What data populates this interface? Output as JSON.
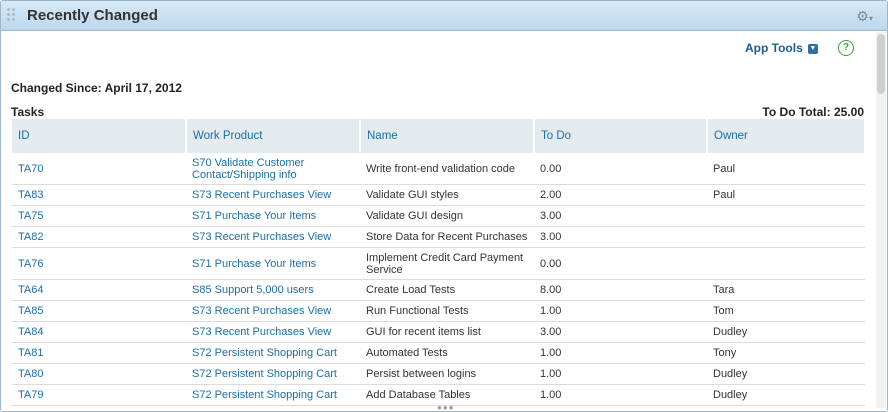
{
  "panel": {
    "title": "Recently Changed"
  },
  "toolbar": {
    "app_tools_label": "App Tools",
    "help_label": "?"
  },
  "changed_since": "Changed Since: April 17, 2012",
  "section_title": "Tasks",
  "todo_total": "To Do Total: 25.00",
  "columns": [
    "ID",
    "Work Product",
    "Name",
    "To Do",
    "Owner"
  ],
  "rows": [
    {
      "id": "TA70",
      "work_product": "S70 Validate Customer Contact/Shipping info",
      "name": "Write front-end validation code",
      "todo": "0.00",
      "owner": "Paul"
    },
    {
      "id": "TA83",
      "work_product": "S73 Recent Purchases View",
      "name": "Validate GUI styles",
      "todo": "2.00",
      "owner": "Paul"
    },
    {
      "id": "TA75",
      "work_product": "S71 Purchase Your Items",
      "name": "Validate GUI design",
      "todo": "3.00",
      "owner": ""
    },
    {
      "id": "TA82",
      "work_product": "S73 Recent Purchases View",
      "name": "Store Data for Recent Purchases",
      "todo": "3.00",
      "owner": ""
    },
    {
      "id": "TA76",
      "work_product": "S71 Purchase Your Items",
      "name": "Implement Credit Card Payment Service",
      "todo": "0.00",
      "owner": ""
    },
    {
      "id": "TA64",
      "work_product": "S85 Support 5,000 users",
      "name": "Create Load Tests",
      "todo": "8.00",
      "owner": "Tara"
    },
    {
      "id": "TA85",
      "work_product": "S73 Recent Purchases View",
      "name": "Run Functional Tests",
      "todo": "1.00",
      "owner": "Tom"
    },
    {
      "id": "TA84",
      "work_product": "S73 Recent Purchases View",
      "name": "GUI for recent items list",
      "todo": "3.00",
      "owner": "Dudley"
    },
    {
      "id": "TA81",
      "work_product": "S72 Persistent Shopping Cart",
      "name": "Automated Tests",
      "todo": "1.00",
      "owner": "Tony"
    },
    {
      "id": "TA80",
      "work_product": "S72 Persistent Shopping Cart",
      "name": "Persist between logins",
      "todo": "1.00",
      "owner": "Dudley"
    },
    {
      "id": "TA79",
      "work_product": "S72 Persistent Shopping Cart",
      "name": "Add Database Tables",
      "todo": "1.00",
      "owner": "Dudley"
    }
  ]
}
